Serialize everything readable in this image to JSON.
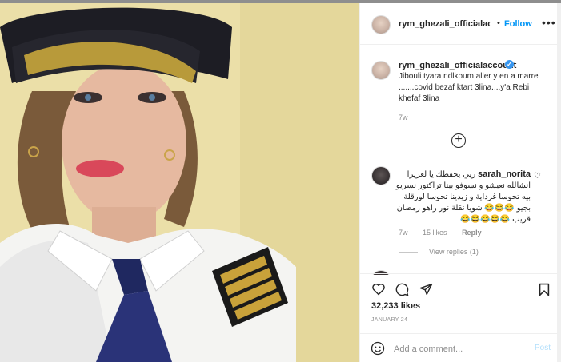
{
  "header": {
    "username": "rym_ghezali_officialaccou",
    "dot": "•",
    "follow_label": "Follow",
    "more_label": "•••"
  },
  "caption": {
    "username": "rym_ghezali_officialaccount",
    "text": "Jibouli tyara ndlkoum aller y en a marre .......covid bezaf ktart 3lina....y'a Rebi khefaf 3lina",
    "time": "7w"
  },
  "load_more_label": "+",
  "comment": {
    "username": "sarah_norita",
    "text": "ربي يحفظك يا لعزيزا انشالله نعيشو و نسوفو بينا تراكتور نسريو بيه تحوسا غرداية و زيدينا تحوسا لورقلة بجيو 😂😂😂 شويا نقلة نور راهو رمضان قريب 😂😂😂😂😂",
    "time": "7w",
    "likes": "15 likes",
    "reply_label": "Reply",
    "view_replies": "View replies (1)"
  },
  "post": {
    "likes": "32,233 likes",
    "date": "JANUARY 24"
  },
  "add_comment": {
    "placeholder": "Add a comment...",
    "post_label": "Post"
  },
  "colors": {
    "accent": "#0095f6",
    "verified": "#3897f0",
    "post_disabled": "#b2dffc",
    "photo_background": "#efe3b0"
  }
}
